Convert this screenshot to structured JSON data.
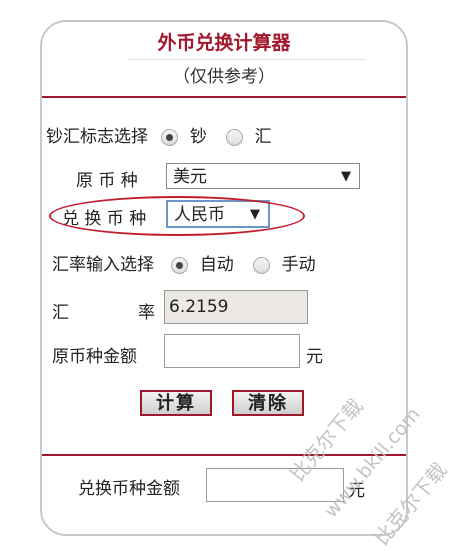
{
  "window": {
    "title": "外币兑换计算器",
    "subtitle": "（仅供参考）"
  },
  "cash_flag": {
    "label": "钞汇标志选择",
    "options": [
      "钞",
      "汇"
    ],
    "selected": "钞"
  },
  "source_currency": {
    "label": "原 币 种",
    "value": "美元"
  },
  "target_currency": {
    "label": "兑 换 币 种",
    "value": "人民币"
  },
  "rate_mode": {
    "label": "汇率输入选择",
    "options": [
      "自动",
      "手动"
    ],
    "selected": "自动"
  },
  "rate": {
    "label_left": "汇",
    "label_right": "率",
    "value": "6.2159"
  },
  "amount": {
    "label": "原币种金额",
    "value": "",
    "unit": "元"
  },
  "buttons": {
    "calculate": "计算",
    "clear": "清除"
  },
  "result": {
    "label": "兑换币种金额",
    "value": "",
    "unit": "元"
  },
  "watermark": {
    "text_1": "比克尔下载",
    "text_2": "www.bkill.com",
    "text_3": "比克尔下载"
  },
  "colors": {
    "accent": "#9c1a2c",
    "highlight_ellipse": "#c21f2e",
    "select_focus": "#6b96c9"
  }
}
